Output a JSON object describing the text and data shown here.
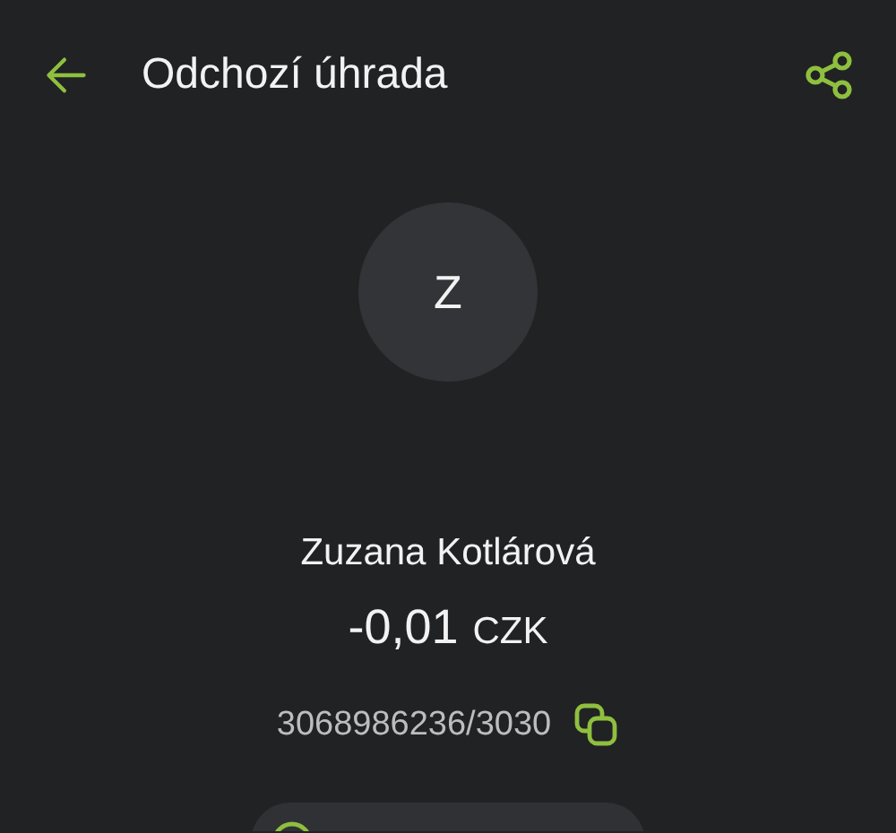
{
  "header": {
    "title": "Odchozí úhrada"
  },
  "payee": {
    "initial": "Z",
    "name": "Zuzana Kotlárová",
    "amount": "-0,01",
    "currency": "CZK",
    "account": "3068986236/3030"
  },
  "category_chip": {
    "kind": "chip"
  }
}
